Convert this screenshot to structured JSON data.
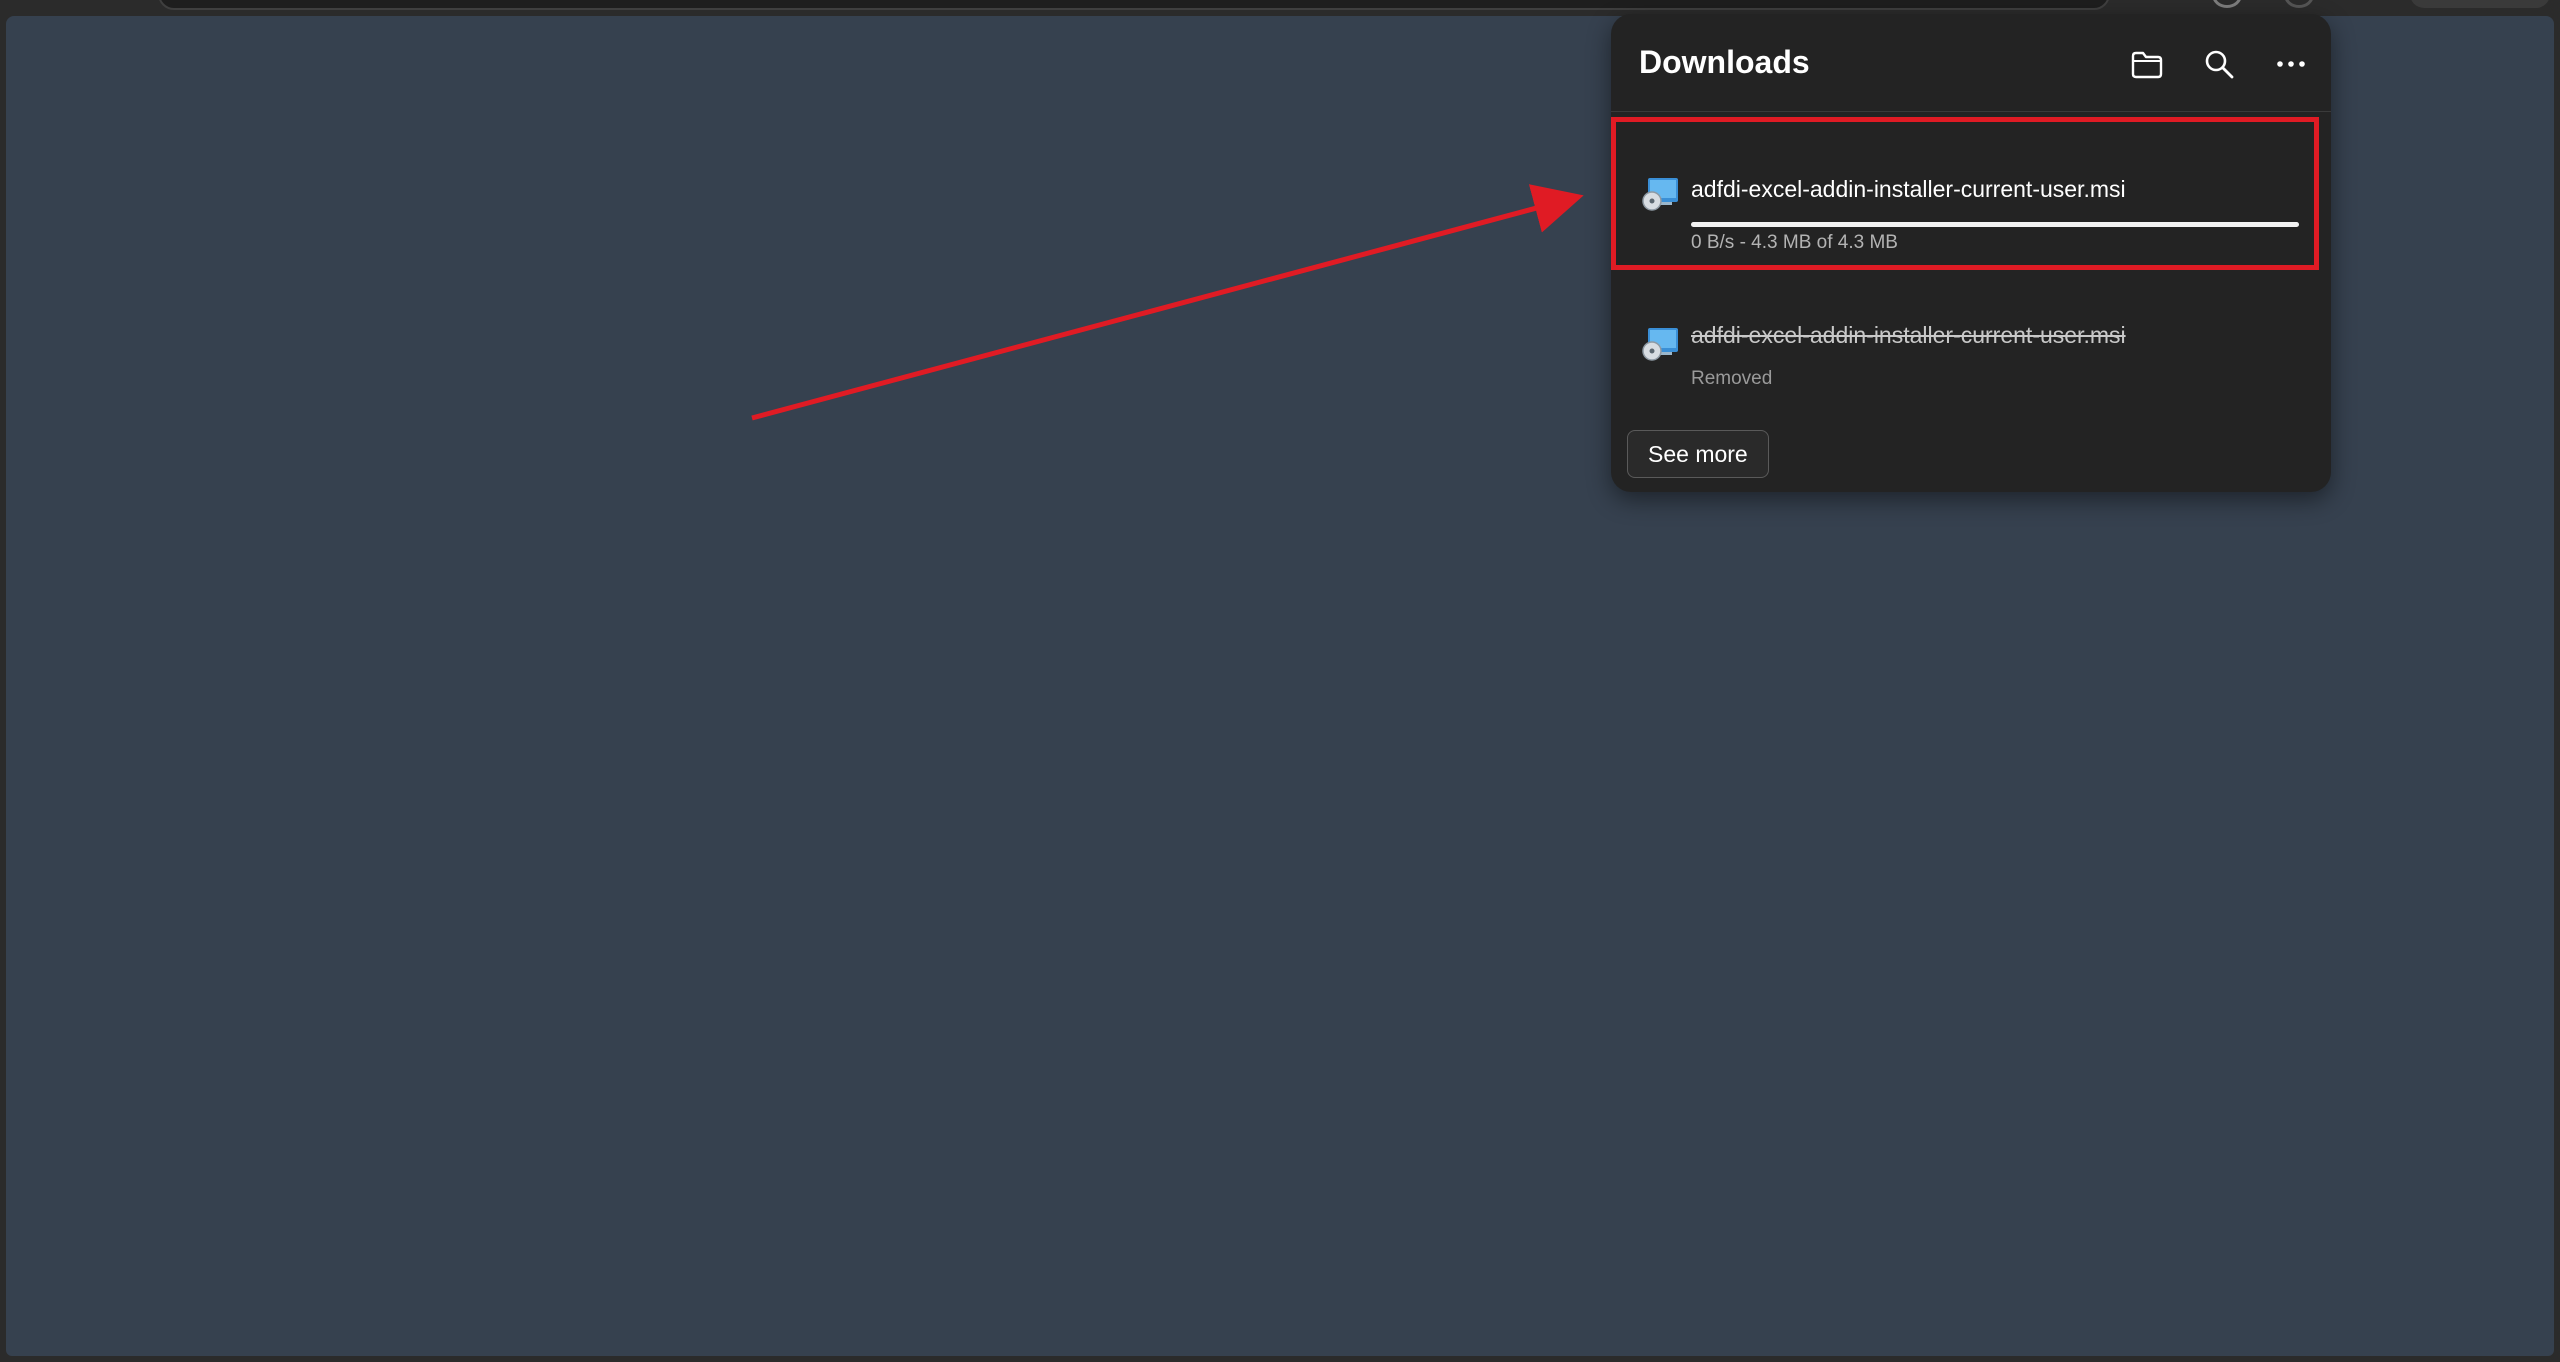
{
  "panel": {
    "title": "Downloads",
    "icons": {
      "open_folder": "folder-icon",
      "search": "search-icon",
      "more": "more-options-icon"
    }
  },
  "downloads": [
    {
      "file_name": "adfdi-excel-addin-installer-current-user.msi",
      "status": "0 B/s - 4.3 MB of 4.3 MB",
      "progress": 1.0,
      "removed": false,
      "icon": "msi-installer-icon"
    },
    {
      "file_name": "adfdi-excel-addin-installer-current-user.msi",
      "status": "Removed",
      "removed": true,
      "icon": "msi-installer-icon"
    }
  ],
  "see_more_label": "See more",
  "colors": {
    "page_background": "#36414f",
    "panel_background": "#232323",
    "annotation_red": "#e01b24"
  }
}
